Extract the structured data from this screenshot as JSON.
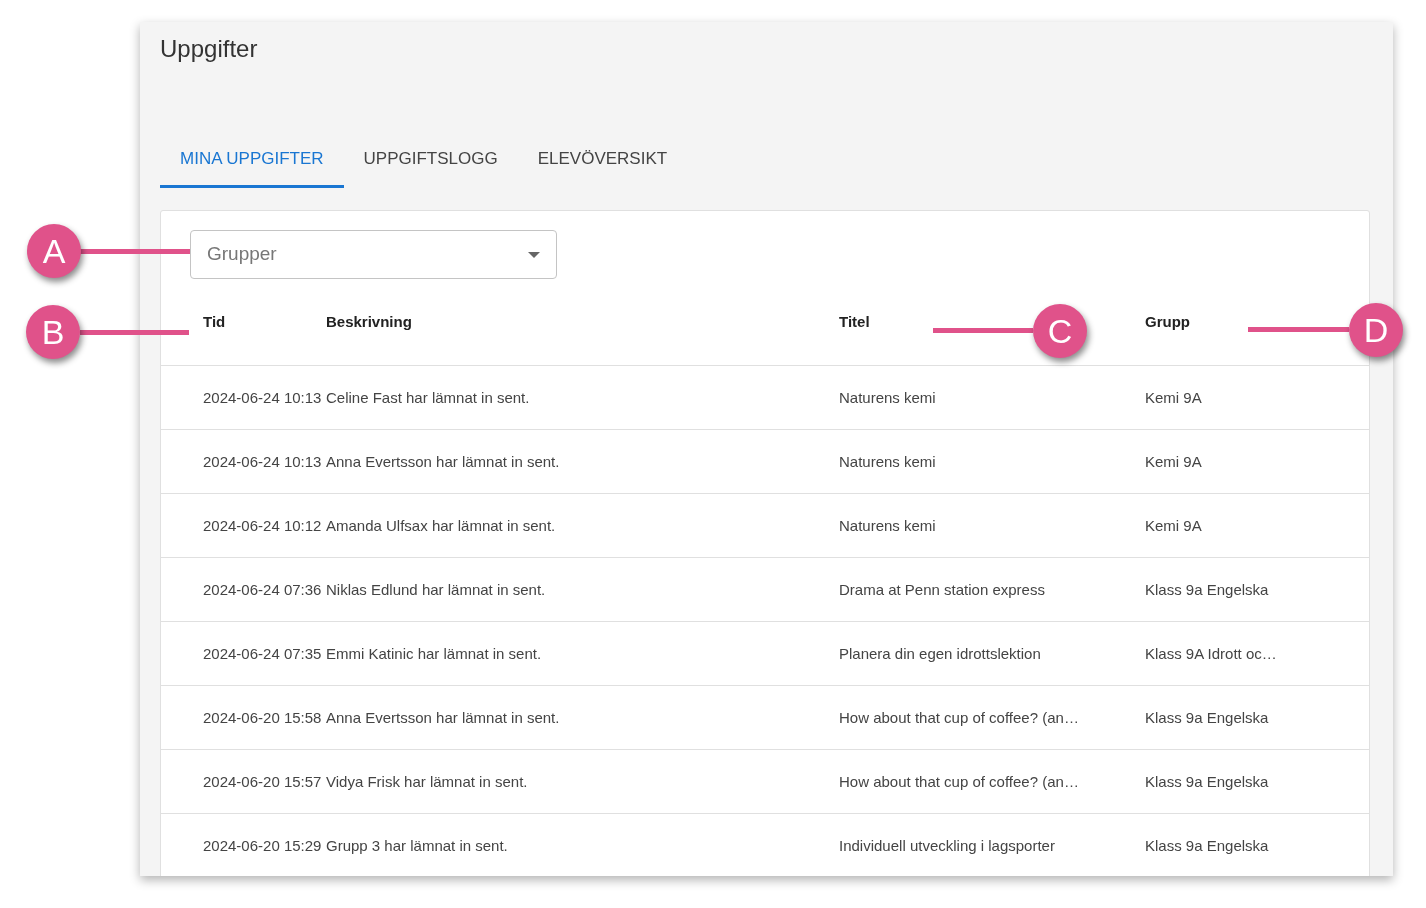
{
  "page": {
    "title": "Uppgifter"
  },
  "tabs": [
    {
      "label": "MINA UPPGIFTER",
      "selected": true
    },
    {
      "label": "UPPGIFTSLOGG",
      "selected": false
    },
    {
      "label": "ELEVÖVERSIKT",
      "selected": false
    }
  ],
  "group_select": {
    "placeholder": "Grupper"
  },
  "table": {
    "columns": [
      "Tid",
      "Beskrivning",
      "Titel",
      "Grupp"
    ],
    "rows": [
      [
        "2024-06-24 10:13",
        "Celine Fast har lämnat in sent.",
        "Naturens kemi",
        "Kemi 9A"
      ],
      [
        "2024-06-24 10:13",
        "Anna Evertsson har lämnat in sent.",
        "Naturens kemi",
        "Kemi 9A"
      ],
      [
        "2024-06-24 10:12",
        "Amanda Ulfsax har lämnat in sent.",
        "Naturens kemi",
        "Kemi 9A"
      ],
      [
        "2024-06-24 07:36",
        "Niklas Edlund har lämnat in sent.",
        "Drama at Penn station express",
        "Klass 9a Engelska"
      ],
      [
        "2024-06-24 07:35",
        "Emmi Katinic har lämnat in sent.",
        "Planera din egen idrottslektion",
        "Klass 9A Idrott oc…"
      ],
      [
        "2024-06-20 15:58",
        "Anna Evertsson har lämnat in sent.",
        "How about that cup of coffee? (an…",
        "Klass 9a Engelska"
      ],
      [
        "2024-06-20 15:57",
        "Vidya Frisk har lämnat in sent.",
        "How about that cup of coffee? (an…",
        "Klass 9a Engelska"
      ],
      [
        "2024-06-20 15:29",
        "Grupp 3 har lämnat in sent.",
        "Individuell utveckling i lagsporter",
        "Klass 9a Engelska"
      ]
    ]
  },
  "callouts": [
    {
      "letter": "A"
    },
    {
      "letter": "B"
    },
    {
      "letter": "C"
    },
    {
      "letter": "D"
    }
  ]
}
